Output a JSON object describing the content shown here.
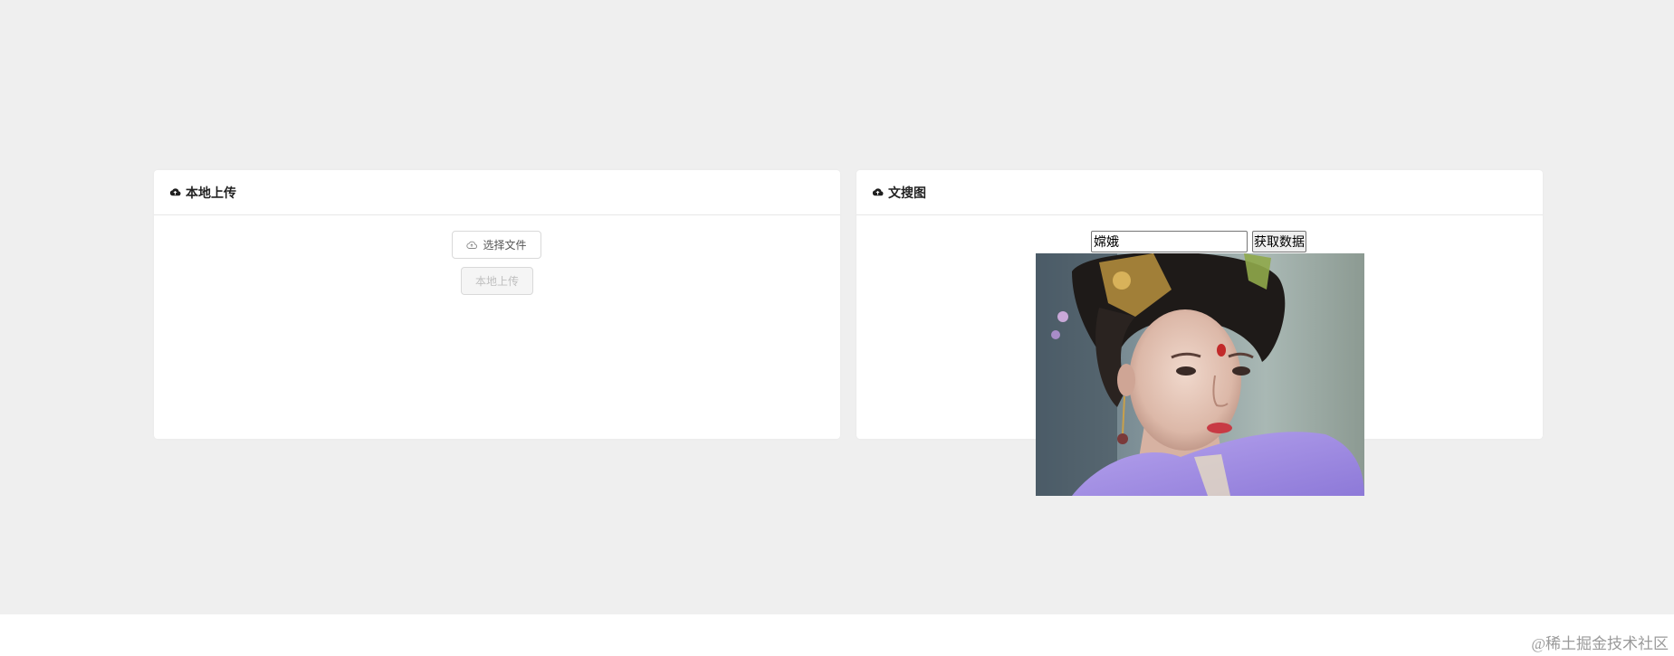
{
  "upload_card": {
    "title": "本地上传",
    "select_file_label": "选择文件",
    "upload_button_label": "本地上传"
  },
  "search_card": {
    "title": "文搜图",
    "query_value": "嫦娥",
    "fetch_button_label": "获取数据"
  },
  "icons": {
    "header_icon": "cloud-upload-icon",
    "select_file_icon": "cloud-icon"
  },
  "colors": {
    "page_background": "#efefef",
    "card_background": "#ffffff",
    "disabled_text": "#bfbfbf"
  },
  "watermark": "@稀土掘金技术社区"
}
